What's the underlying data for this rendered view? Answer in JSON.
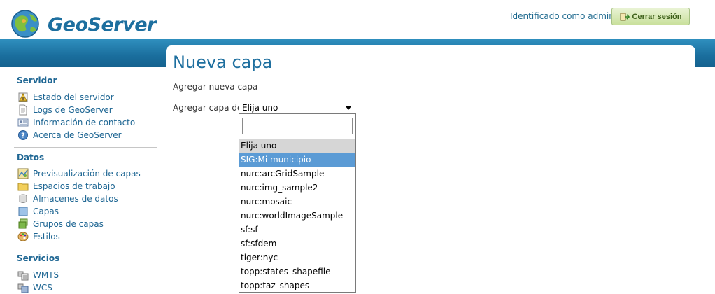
{
  "header": {
    "app_name": "GeoServer",
    "login_text": "Identificado como admin.",
    "logout_label": "Cerrar sesión"
  },
  "sidebar": {
    "sections": [
      {
        "title": "Servidor",
        "items": [
          {
            "label": "Estado del servidor",
            "icon": "server-status-icon"
          },
          {
            "label": "Logs de GeoServer",
            "icon": "document-icon"
          },
          {
            "label": "Información de contacto",
            "icon": "contact-card-icon"
          },
          {
            "label": "Acerca de GeoServer",
            "icon": "help-icon"
          }
        ]
      },
      {
        "title": "Datos",
        "items": [
          {
            "label": "Previsualización de capas",
            "icon": "map-preview-icon"
          },
          {
            "label": "Espacios de trabajo",
            "icon": "folder-icon"
          },
          {
            "label": "Almacenes de datos",
            "icon": "database-icon"
          },
          {
            "label": "Capas",
            "icon": "layer-icon"
          },
          {
            "label": "Grupos de capas",
            "icon": "layer-group-icon"
          },
          {
            "label": "Estilos",
            "icon": "palette-icon"
          }
        ]
      },
      {
        "title": "Servicios",
        "items": [
          {
            "label": "WMTS",
            "icon": "wmts-icon"
          },
          {
            "label": "WCS",
            "icon": "wcs-icon"
          }
        ]
      }
    ]
  },
  "main": {
    "title": "Nueva capa",
    "subtitle": "Agregar nueva capa",
    "field_label": "Agregar capa de",
    "select": {
      "selected": "Elija uno",
      "search_value": "",
      "options": [
        "Elija uno",
        "SIG:Mi municipio",
        "nurc:arcGridSample",
        "nurc:img_sample2",
        "nurc:mosaic",
        "nurc:worldImageSample",
        "sf:sf",
        "sf:sfdem",
        "tiger:nyc",
        "topp:states_shapefile",
        "topp:taz_shapes"
      ],
      "highlighted": "SIG:Mi municipio"
    }
  },
  "colors": {
    "accent": "#1e6693",
    "band": "#1a6e9d",
    "logout_bg": "#c9e09c",
    "highlight": "#5b9bd5"
  }
}
